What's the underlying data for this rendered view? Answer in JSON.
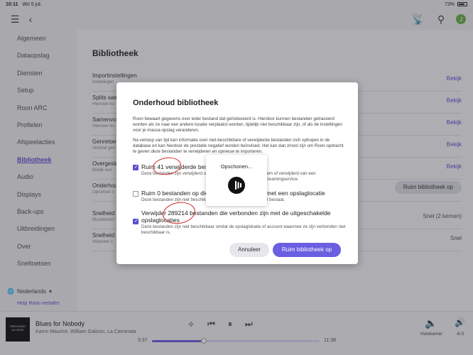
{
  "status": {
    "time": "10:11",
    "date": "Wo 5 jul.",
    "battery": "73%"
  },
  "topbar": {
    "menu_icon": "hamburger-icon",
    "back_icon": "chevron-left-icon",
    "avatar_letter": "J"
  },
  "sidebar": {
    "items": [
      {
        "label": "Algemeen"
      },
      {
        "label": "Dataopslag"
      },
      {
        "label": "Diensten"
      },
      {
        "label": "Setup"
      },
      {
        "label": "Roon ARC"
      },
      {
        "label": "Profielen"
      },
      {
        "label": "Afspeelacties"
      },
      {
        "label": "Bibliotheek",
        "active": true
      },
      {
        "label": "Audio"
      },
      {
        "label": "Displays"
      },
      {
        "label": "Back-ups"
      },
      {
        "label": "Uitbreidingen"
      },
      {
        "label": "Over"
      },
      {
        "label": "Sneltoetsen"
      }
    ],
    "language": "Nederlands",
    "help": "Help Roon vertalen"
  },
  "main": {
    "title": "Bibliotheek",
    "rows": [
      {
        "title": "Importinstellingen",
        "sub": "Instellingen",
        "action": "Bekijk"
      },
      {
        "title": "Splits sam",
        "sub": "Hiermee ku",
        "action": "Bekijk"
      },
      {
        "title": "Samenvoe",
        "sub": "Hiermee ku",
        "action": "Bekijk"
      },
      {
        "title": "Genretoe",
        "sub": "Verbind gen",
        "action": "Bekijk"
      },
      {
        "title": "Overgesla",
        "sub": "Bekijk een",
        "action": "Bekijk"
      },
      {
        "title": "Onderhou",
        "sub": "Opruimen v",
        "action": "Ruim bibliotheek op"
      },
      {
        "title": "Snelheid",
        "sub": "Muziekbest",
        "action": "Snel (2 kernen)"
      },
      {
        "title": "Snelheid",
        "sub": "Wanneer e",
        "action": "Snel"
      }
    ]
  },
  "dialog": {
    "title": "Onderhoud bibliotheek",
    "para1": "Roon bewaart gegevens over ieder bestand dat geïndexeerd is. Hierdoor kunnen bestanden getraceerd worden als ze naar een andere locatie verplaatst worden, tijdelijk niet beschikbaar zijn, of als de instellingen voor je massa-opslag veranderen.",
    "para2": "Na verloop van tijd kan informatie over niet-beschikbare of verwijderde bestanden zich ophopen in de database en kan hierdoor de prestatie negatief worden beïnvloed. Het kan dan zinvol zijn om Roon opdracht te geven deze bestanden te verwijderen en opnieuw te importeren.",
    "options": [
      {
        "label": "Ruim 41 verwijderde best",
        "label_tail": "eem of verwijderd van een streamingservice.",
        "desc": "Deze bestanden zijn verwijderd uit",
        "checked": true
      },
      {
        "label": "Ruim 0 bestanden op die",
        "label_tail": "met een opslaglocatie",
        "desc": "Deze bestanden zijn niet beschikbaar",
        "desc_tail": "er bestaat.",
        "checked": false
      },
      {
        "label": "Verwijder 289214 bestanden die verbonden zijn met de uitgeschakelde opslaglocaties",
        "desc": "Deze bestanden zijn niet beschikbaar omdat de opslaglokatie of account waarmee ze zijn verbonden niet beschikbaar is.",
        "checked": true
      }
    ],
    "cancel": "Annuleer",
    "confirm": "Ruim bibliotheek op"
  },
  "progress_popup": {
    "text": "Opschonen...",
    "icon": "roon-logo-icon"
  },
  "player": {
    "album_art_text": "GREGORIO ALLEGRI",
    "track": "Blues for Nobody",
    "artist": "Karim Maurice, William Galison, La Camerata",
    "elapsed": "3:37",
    "duration": "11:38",
    "progress": 0.31,
    "zone": "Hulskamer",
    "volume": "-6.0"
  }
}
